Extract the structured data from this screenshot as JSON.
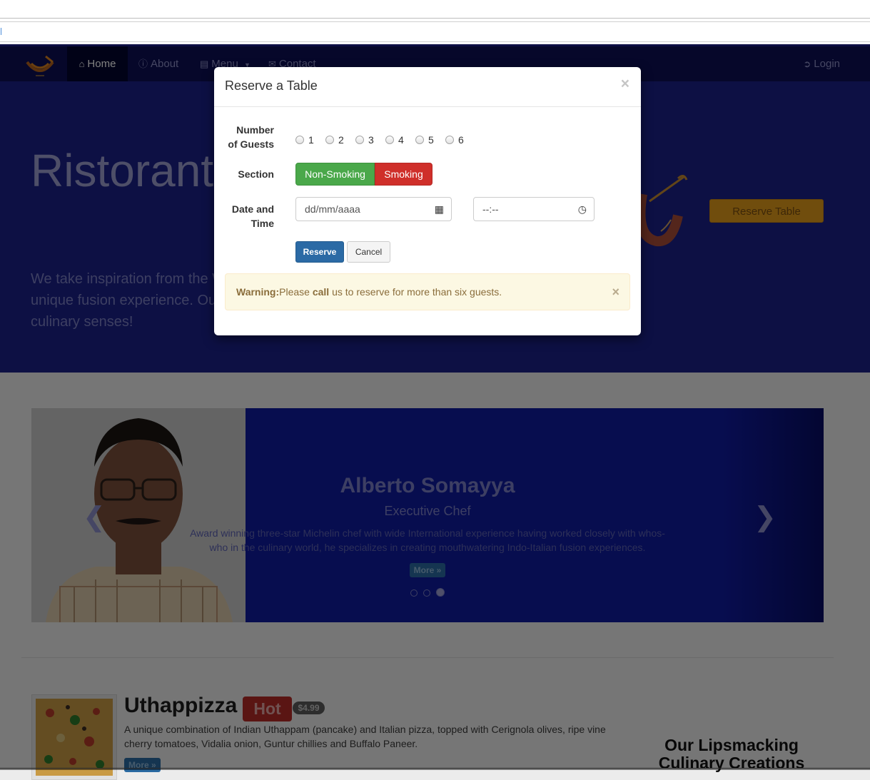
{
  "navbar": {
    "home": "Home",
    "about": "About",
    "menu": "Menu",
    "contact": "Contact",
    "login": "Login"
  },
  "hero": {
    "title": "Ristorante con Fusion",
    "text": "We take inspiration from the World's best cuisines, and create a unique fusion experience. Our lipsmacking creations will tickle your culinary senses!",
    "reserve_button": "Reserve Table"
  },
  "carousel": {
    "name": "Alberto Somayya",
    "role": "Executive Chef",
    "description": "Award winning three-star Michelin chef with wide International experience having worked closely with whos-who in the culinary world, he specializes in creating mouthwatering Indo-Italian fusion experiences.",
    "more": "More »",
    "slide_count": 3,
    "active_slide": 3
  },
  "dish": {
    "title": "Uthappizza",
    "badge": "Hot",
    "price": "$4.99",
    "description": "A unique combination of Indian Uthappam (pancake) and Italian pizza, topped with Cerignola olives, ripe vine cherry tomatoes, Vidalia onion, Guntur chillies and Buffalo Paneer.",
    "more": "More »"
  },
  "side": {
    "title": "Our Lipsmacking Culinary Creations"
  },
  "modal": {
    "title": "Reserve a Table",
    "close": "×",
    "guests_label_1": "Number",
    "guests_label_2": "of Guests",
    "guest_options": [
      "1",
      "2",
      "3",
      "4",
      "5",
      "6"
    ],
    "section_label": "Section",
    "non_smoking": "Non-Smoking",
    "smoking": "Smoking",
    "datetime_label_1": "Date and",
    "datetime_label_2": "Time",
    "date_placeholder": "dd/mm/aaaa",
    "time_placeholder": "--:--",
    "reserve": "Reserve",
    "cancel": "Cancel",
    "alert_strong": "Warning:",
    "alert_pre": "Please ",
    "alert_call": "call",
    "alert_post": " us to reserve for more than six guests.",
    "alert_close": "×"
  },
  "colors": {
    "navbar": "#0d0f55",
    "hero": "#1a2088",
    "reserve_hero": "#e09a1a",
    "non_smoking": "#4aa84a",
    "smoking": "#cf2f2a",
    "primary": "#2b6aa5",
    "warning_bg": "#fcf8e3"
  }
}
